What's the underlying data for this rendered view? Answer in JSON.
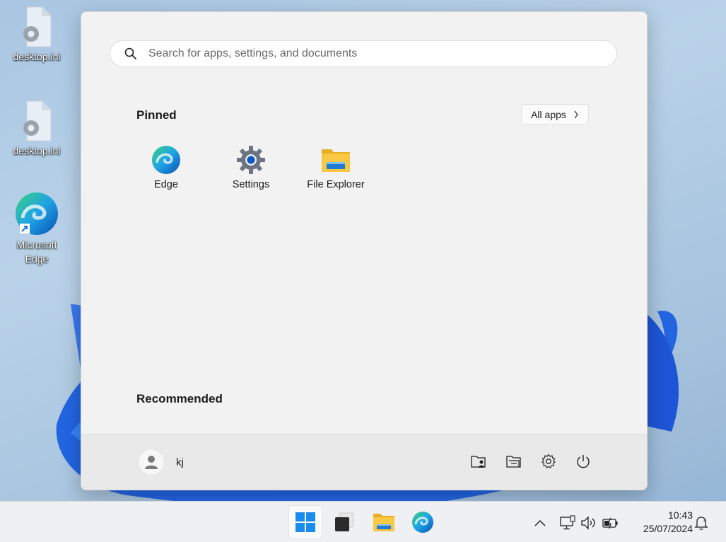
{
  "desktop": {
    "icons": [
      {
        "label": "desktop.ini",
        "icon": "settings-file-icon"
      },
      {
        "label": "desktop.ini",
        "icon": "settings-file-icon"
      },
      {
        "label": "Microsoft Edge",
        "icon": "edge-shortcut-icon"
      }
    ]
  },
  "start_menu": {
    "search": {
      "placeholder": "Search for apps, settings, and documents",
      "icon": "search-icon"
    },
    "pinned": {
      "title": "Pinned",
      "all_apps_label": "All apps",
      "apps": [
        {
          "label": "Edge",
          "icon": "edge-icon"
        },
        {
          "label": "Settings",
          "icon": "settings-gear-icon"
        },
        {
          "label": "File Explorer",
          "icon": "folder-icon"
        }
      ]
    },
    "recommended": {
      "title": "Recommended"
    },
    "footer": {
      "user_name": "kj",
      "buttons": [
        "user-folder-icon",
        "documents-folder-icon",
        "settings-icon",
        "power-icon"
      ]
    }
  },
  "taskbar": {
    "apps": [
      "windows-start-icon",
      "terminal-icon",
      "file-explorer-icon",
      "edge-icon"
    ],
    "tray": [
      "chevron-up-icon",
      "network-icon",
      "volume-icon",
      "battery-icon"
    ],
    "time": "10:43",
    "date": "25/07/2024",
    "notification_icon": "notification-bell-icon"
  },
  "colors": {
    "accent": "#0067c0",
    "folder": "#f4c43a"
  }
}
